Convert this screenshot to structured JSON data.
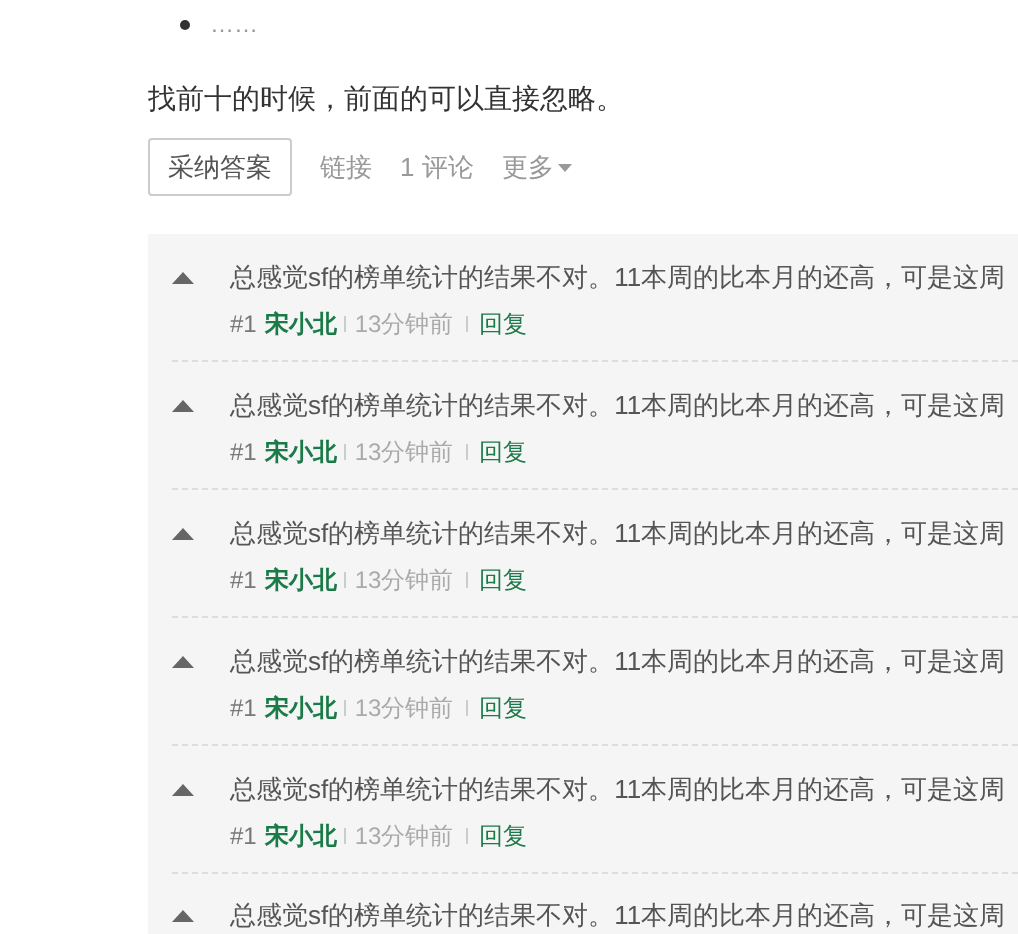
{
  "list_items": [
    "……"
  ],
  "paragraph": "找前十的时候，前面的可以直接忽略。",
  "actions": {
    "accept_button": "采纳答案",
    "links": [
      {
        "label": "链接"
      },
      {
        "label": "1 评论"
      }
    ],
    "more_menu": "更多"
  },
  "comments": [
    {
      "text": "总感觉sf的榜单统计的结果不对。11本周的比本月的还高，可是这周",
      "number": "#1",
      "author": "宋小北",
      "time": "13分钟前",
      "reply": "回复"
    },
    {
      "text": "总感觉sf的榜单统计的结果不对。11本周的比本月的还高，可是这周",
      "number": "#1",
      "author": "宋小北",
      "time": "13分钟前",
      "reply": "回复"
    },
    {
      "text": "总感觉sf的榜单统计的结果不对。11本周的比本月的还高，可是这周",
      "number": "#1",
      "author": "宋小北",
      "time": "13分钟前",
      "reply": "回复"
    },
    {
      "text": "总感觉sf的榜单统计的结果不对。11本周的比本月的还高，可是这周",
      "number": "#1",
      "author": "宋小北",
      "time": "13分钟前",
      "reply": "回复"
    },
    {
      "text": "总感觉sf的榜单统计的结果不对。11本周的比本月的还高，可是这周",
      "number": "#1",
      "author": "宋小北",
      "time": "13分钟前",
      "reply": "回复"
    },
    {
      "text": "总感觉sf的榜单统计的结果不对。11本周的比本月的还高，可是这周"
    }
  ]
}
